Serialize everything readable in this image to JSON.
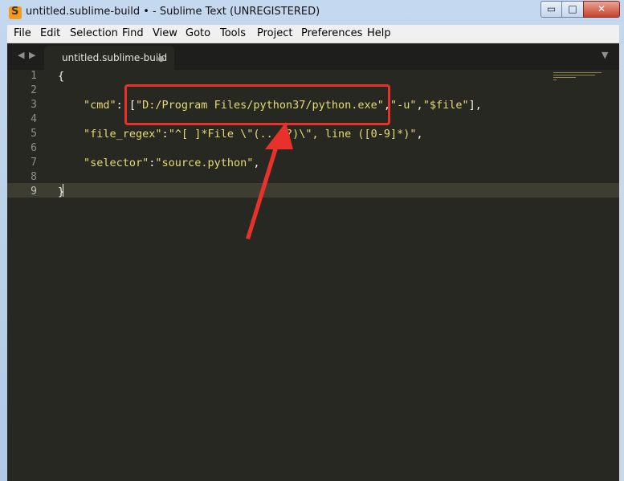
{
  "window": {
    "title": "untitled.sublime-build • - Sublime Text (UNREGISTERED)",
    "app_icon_glyph": "S",
    "minimize_glyph": "▭",
    "maximize_glyph": "□",
    "close_glyph": "✕"
  },
  "menu": [
    "File",
    "Edit",
    "Selection",
    "Find",
    "View",
    "Goto",
    "Tools",
    "Project",
    "Preferences",
    "Help"
  ],
  "tabbar": {
    "nav_back_glyph": "◀",
    "nav_forward_glyph": "▶",
    "tab_label": "untitled.sublime-build",
    "tab_dirty": true,
    "dropdown_glyph": "▼"
  },
  "editor": {
    "line_numbers": [
      "1",
      "2",
      "3",
      "4",
      "5",
      "6",
      "7",
      "8",
      "9"
    ],
    "active_line": "9",
    "lines": {
      "l1": "{",
      "l3_key": "\"cmd\"",
      "l3_colon": ": [",
      "l3_v1": "\"D:/Program Files/python37/python.exe\"",
      "l3_sep1": ",",
      "l3_v2": "\"-u\"",
      "l3_sep2": ",",
      "l3_v3": "\"$file\"",
      "l3_end": "],",
      "l5_key": "\"file_regex\"",
      "l5_colon": ":",
      "l5_val": "\"^[ ]*File \\\"(...*?)\\\", line ([0-9]*)\"",
      "l5_end": ",",
      "l7_key": "\"selector\"",
      "l7_colon": ":",
      "l7_val": "\"source.python\"",
      "l7_end": ",",
      "l9": "}"
    }
  },
  "colors": {
    "editor_bg": "#272822",
    "string": "#e6db74",
    "annotation": "#e8312b"
  },
  "annotation": {
    "highlight": "python.exe path highlighted",
    "arrow": "points up to highlighted path"
  }
}
